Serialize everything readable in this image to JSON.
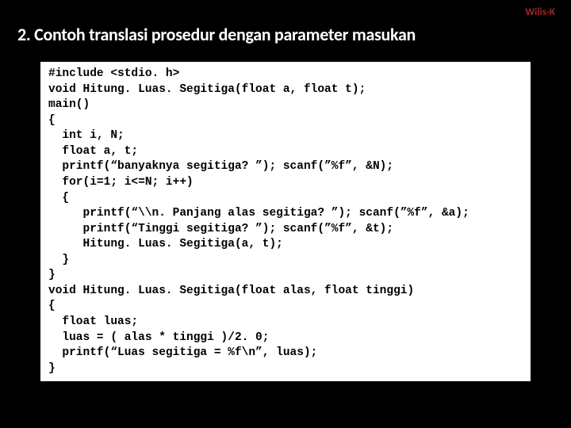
{
  "watermark": "Wilis-K",
  "title": "2. Contoh translasi prosedur dengan parameter masukan",
  "code": "#include <stdio. h>\nvoid Hitung. Luas. Segitiga(float a, float t);\nmain()\n{\n  int i, N;\n  float a, t;\n  printf(“banyaknya segitiga? ”); scanf(”%f”, &N);\n  for(i=1; i<=N; i++)\n  {\n     printf(“\\\\n. Panjang alas segitiga? ”); scanf(”%f”, &a);\n     printf(“Tinggi segitiga? ”); scanf(”%f”, &t);\n     Hitung. Luas. Segitiga(a, t);\n  }\n}\nvoid Hitung. Luas. Segitiga(float alas, float tinggi)\n{\n  float luas;\n  luas = ( alas * tinggi )/2. 0;\n  printf(“Luas segitiga = %f\\n”, luas);\n}"
}
